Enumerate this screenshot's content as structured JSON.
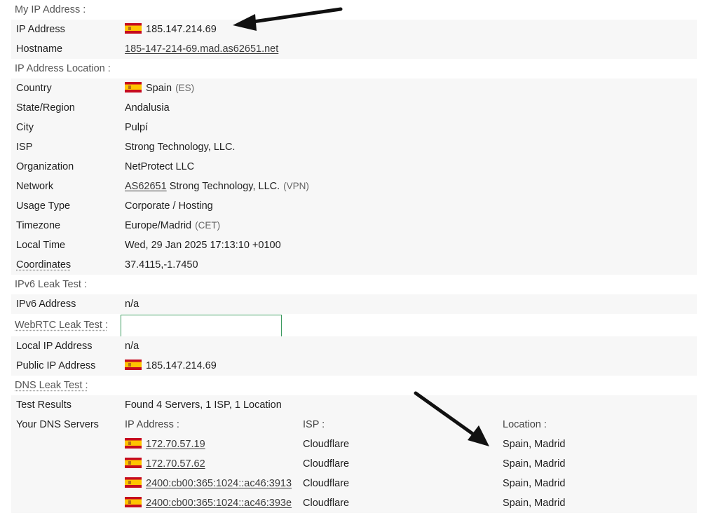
{
  "my_ip": {
    "section_title": "My IP Address :",
    "ip_label": "IP Address",
    "ip_value": "185.147.214.69",
    "hostname_label": "Hostname",
    "hostname_value": "185-147-214-69.mad.as62651.net"
  },
  "location": {
    "section_title": "IP Address Location :",
    "rows": [
      {
        "label": "Country",
        "value": "Spain",
        "extra": "(ES)",
        "flag": true
      },
      {
        "label": "State/Region",
        "value": "Andalusia"
      },
      {
        "label": "City",
        "value": "Pulpí"
      },
      {
        "label": "ISP",
        "value": "Strong Technology, LLC."
      },
      {
        "label": "Organization",
        "value": "NetProtect LLC"
      },
      {
        "label": "Network",
        "link": "AS62651",
        "value": " Strong Technology, LLC.",
        "extra": "(VPN)"
      },
      {
        "label": "Usage Type",
        "value": "Corporate / Hosting"
      },
      {
        "label": "Timezone",
        "value": "Europe/Madrid",
        "extra": "(CET)"
      },
      {
        "label": "Local Time",
        "value": "Wed, 29 Jan 2025 17:13:10 +0100"
      },
      {
        "label": "Coordinates",
        "value": "37.4115,-1.7450"
      }
    ]
  },
  "ipv6": {
    "section_title": "IPv6 Leak Test :",
    "label": "IPv6 Address",
    "value": "n/a"
  },
  "webrtc": {
    "section_title": "WebRTC Leak Test :",
    "local_label": "Local IP Address",
    "local_value": "n/a",
    "public_label": "Public IP Address",
    "public_value": "185.147.214.69"
  },
  "dns": {
    "section_title": "DNS Leak Test :",
    "results_label": "Test Results",
    "results_value": "Found 4 Servers, 1 ISP, 1 Location",
    "servers_label": "Your DNS Servers",
    "col_ip": "IP Address :",
    "col_isp": "ISP :",
    "col_location": "Location :",
    "servers": [
      {
        "ip": "172.70.57.19",
        "isp": "Cloudflare",
        "location": "Spain, Madrid"
      },
      {
        "ip": "172.70.57.62",
        "isp": "Cloudflare",
        "location": "Spain, Madrid"
      },
      {
        "ip": "2400:cb00:365:1024::ac46:3913",
        "isp": "Cloudflare",
        "location": "Spain, Madrid"
      },
      {
        "ip": "2400:cb00:365:1024::ac46:393e",
        "isp": "Cloudflare",
        "location": "Spain, Madrid"
      }
    ]
  },
  "icons": {
    "flag": "spain-flag-icon",
    "arrow": "black-arrow-annotation"
  }
}
